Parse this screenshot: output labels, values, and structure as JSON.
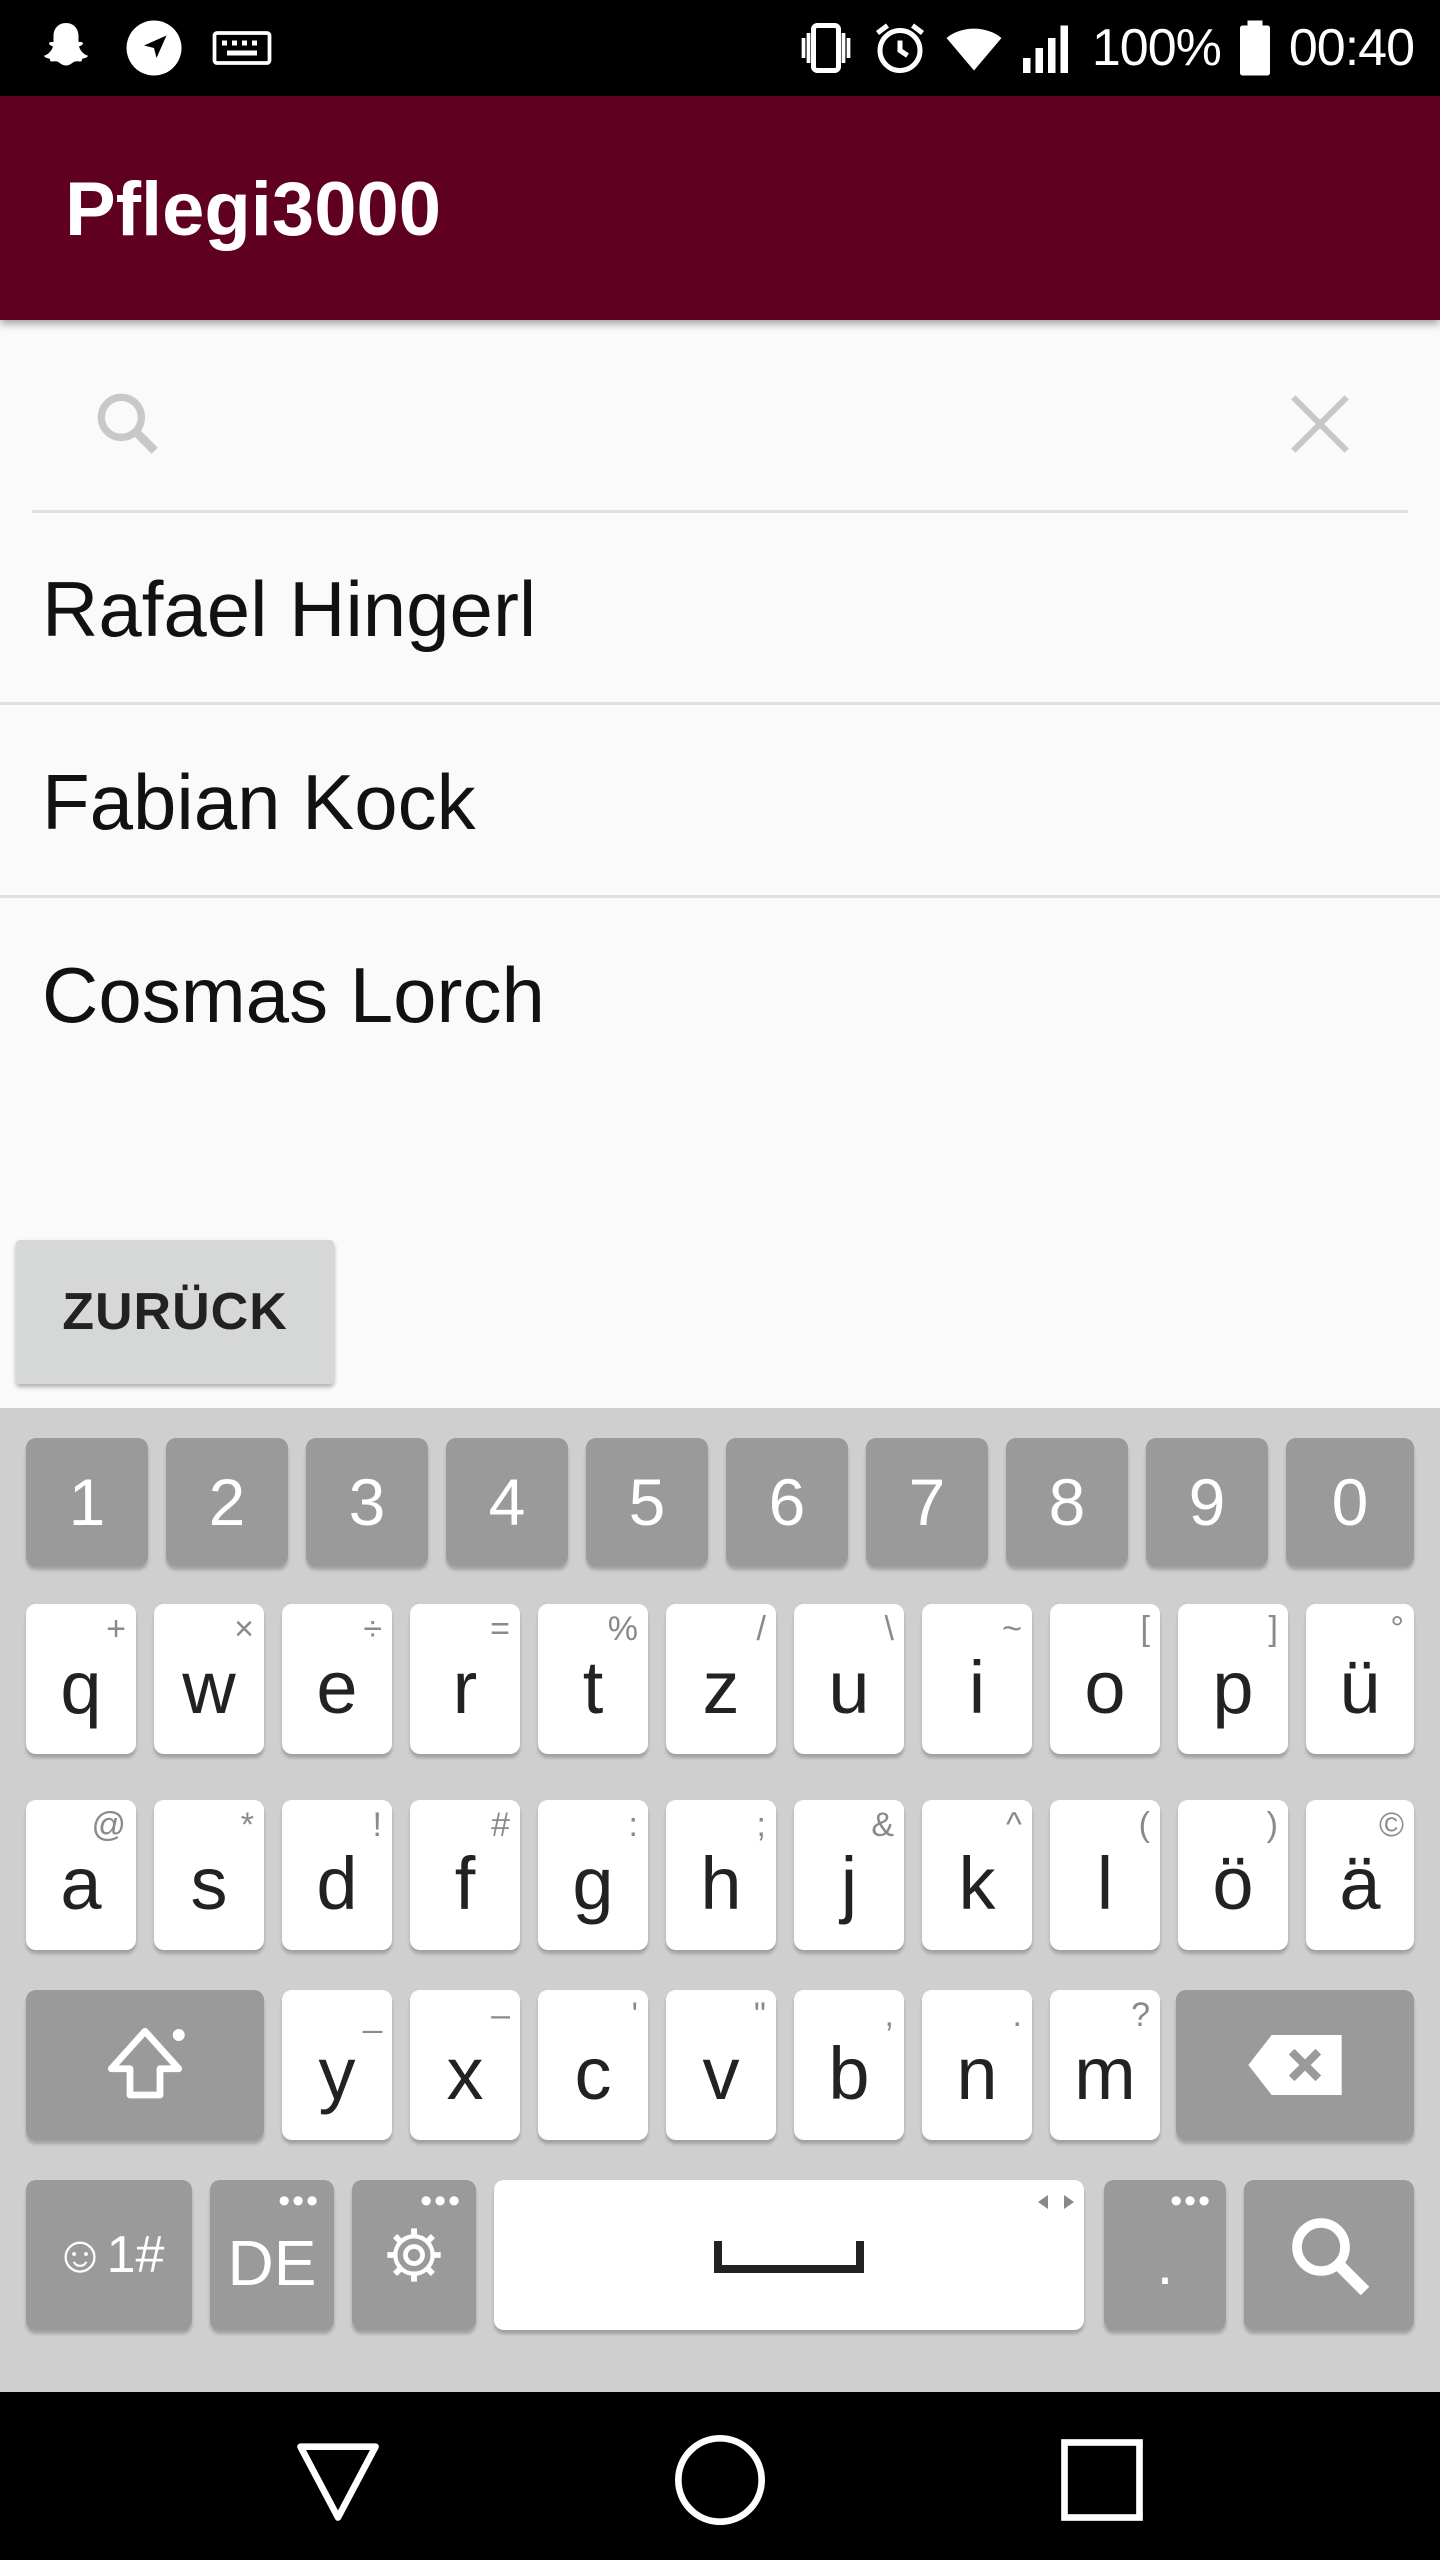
{
  "status_bar": {
    "battery_percent": "100%",
    "time": "00:40",
    "icons_left": [
      "snapchat-icon",
      "navigation-icon",
      "keyboard-icon"
    ],
    "icons_right": [
      "vibrate-icon",
      "alarm-icon",
      "wifi-icon",
      "signal-icon",
      "battery-icon"
    ]
  },
  "app_bar": {
    "title": "Pflegi3000",
    "color": "#600020"
  },
  "search": {
    "value": "",
    "placeholder": ""
  },
  "list": {
    "items": [
      {
        "label": "Rafael Hingerl"
      },
      {
        "label": "Fabian Kock"
      },
      {
        "label": "Cosmas Lorch"
      }
    ]
  },
  "back_button": {
    "label": "ZURÜCK"
  },
  "keyboard": {
    "number_row": [
      "1",
      "2",
      "3",
      "4",
      "5",
      "6",
      "7",
      "8",
      "9",
      "0"
    ],
    "row1": [
      {
        "key": "q",
        "hint": "+"
      },
      {
        "key": "w",
        "hint": "×"
      },
      {
        "key": "e",
        "hint": "÷"
      },
      {
        "key": "r",
        "hint": "="
      },
      {
        "key": "t",
        "hint": "%"
      },
      {
        "key": "z",
        "hint": "/"
      },
      {
        "key": "u",
        "hint": "\\"
      },
      {
        "key": "i",
        "hint": "~"
      },
      {
        "key": "o",
        "hint": "["
      },
      {
        "key": "p",
        "hint": "]"
      },
      {
        "key": "ü",
        "hint": "°"
      }
    ],
    "row2": [
      {
        "key": "a",
        "hint": "@"
      },
      {
        "key": "s",
        "hint": "*"
      },
      {
        "key": "d",
        "hint": "!"
      },
      {
        "key": "f",
        "hint": "#"
      },
      {
        "key": "g",
        "hint": ":"
      },
      {
        "key": "h",
        "hint": ";"
      },
      {
        "key": "j",
        "hint": "&"
      },
      {
        "key": "k",
        "hint": "^"
      },
      {
        "key": "l",
        "hint": "("
      },
      {
        "key": "ö",
        "hint": ")"
      },
      {
        "key": "ä",
        "hint": "©"
      }
    ],
    "row3": [
      {
        "key": "y",
        "hint": "_"
      },
      {
        "key": "x",
        "hint": "–"
      },
      {
        "key": "c",
        "hint": "'"
      },
      {
        "key": "v",
        "hint": "\""
      },
      {
        "key": "b",
        "hint": ","
      },
      {
        "key": "n",
        "hint": "."
      },
      {
        "key": "m",
        "hint": "?"
      }
    ],
    "symbols_label": "☺1#",
    "language_label": "DE",
    "period_label": ".",
    "dots": "•••"
  }
}
